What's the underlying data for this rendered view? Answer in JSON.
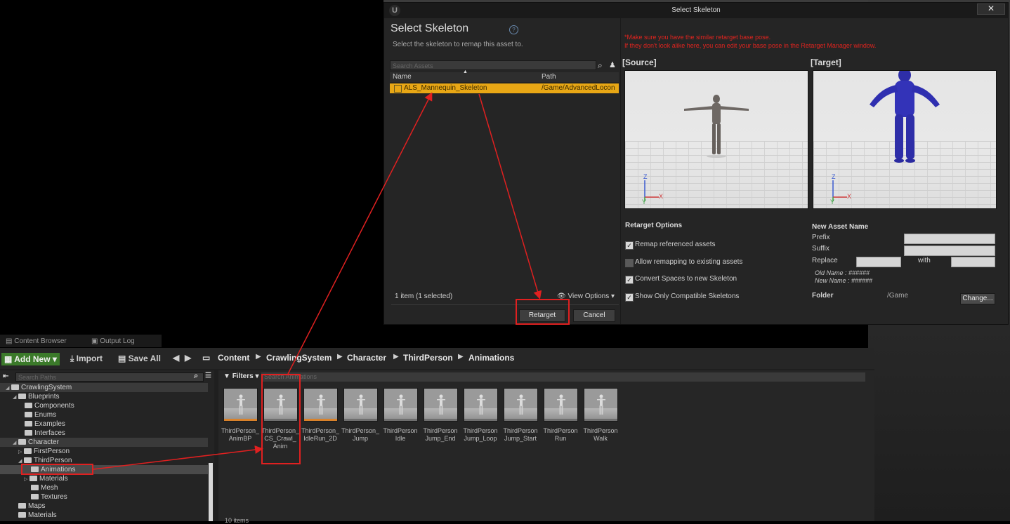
{
  "dialog": {
    "window_title": "Select Skeleton",
    "close_glyph": "✕",
    "heading": "Select Skeleton",
    "subtitle": "Select the skeleton to remap this asset to.",
    "search_placeholder": "Search Assets",
    "columns": {
      "name": "Name",
      "path": "Path"
    },
    "selected_row": {
      "name": "ALS_Mannequin_Skeleton",
      "path": "/Game/AdvancedLocon"
    },
    "count_text": "1 item (1 selected)",
    "view_options": "View Options",
    "retarget_button": "Retarget",
    "cancel_button": "Cancel",
    "warning_line1": "*Make sure you have the similar retarget base pose.",
    "warning_line2": "If they don't look alike here, you can edit your base pose in the Retarget Manager window.",
    "source_label": "[Source]",
    "target_label": "[Target]",
    "axis_z": "Z",
    "axis_x": "X",
    "axis_y": "Y",
    "retarget_options_title": "Retarget Options",
    "options": [
      {
        "label": "Remap referenced assets",
        "checked": true
      },
      {
        "label": "Allow remapping to existing assets",
        "checked": false
      },
      {
        "label": "Convert Spaces to new Skeleton",
        "checked": true
      },
      {
        "label": "Show Only Compatible Skeletons",
        "checked": true
      }
    ],
    "check_glyph": "✓",
    "new_asset_title": "New Asset Name",
    "prefix_label": "Prefix",
    "suffix_label": "Suffix",
    "replace_label": "Replace",
    "with_label": "with",
    "old_name": "Old Name : ######",
    "new_name": "New Name : ######",
    "folder_label": "Folder",
    "folder_value": "/Game",
    "change_button": "Change..."
  },
  "content_browser": {
    "tabs": [
      "Content Browser",
      "Output Log"
    ],
    "add_new": "Add New ▾",
    "import": "Import",
    "save_all": "Save All",
    "breadcrumb": [
      "Content",
      "CrawlingSystem",
      "Character",
      "ThirdPerson",
      "Animations"
    ],
    "search_paths_placeholder": "Search Paths",
    "filters": "Filters ▾",
    "search_animations_placeholder": "Search Animations",
    "tree": {
      "crawling": "CrawlingSystem",
      "blueprints": "Blueprints",
      "components": "Components",
      "enums": "Enums",
      "examples": "Examples",
      "interfaces": "Interfaces",
      "character": "Character",
      "first_person": "FirstPerson",
      "third_person": "ThirdPerson",
      "animations": "Animations",
      "materials": "Materials",
      "mesh": "Mesh",
      "textures": "Textures",
      "maps": "Maps",
      "materials_root": "Materials"
    },
    "assets": [
      {
        "line1": "ThirdPerson_",
        "line2": "AnimBP",
        "line3": ""
      },
      {
        "line1": "ThirdPerson_",
        "line2": "CS_Crawl_",
        "line3": "Anim"
      },
      {
        "line1": "ThirdPerson_",
        "line2": "IdleRun_2D",
        "line3": ""
      },
      {
        "line1": "ThirdPerson_",
        "line2": "Jump",
        "line3": ""
      },
      {
        "line1": "ThirdPerson",
        "line2": "Idle",
        "line3": ""
      },
      {
        "line1": "ThirdPerson",
        "line2": "Jump_End",
        "line3": ""
      },
      {
        "line1": "ThirdPerson",
        "line2": "Jump_Loop",
        "line3": ""
      },
      {
        "line1": "ThirdPerson",
        "line2": "Jump_Start",
        "line3": ""
      },
      {
        "line1": "ThirdPerson",
        "line2": "Run",
        "line3": ""
      },
      {
        "line1": "ThirdPerson",
        "line2": "Walk",
        "line3": ""
      }
    ],
    "items_count": "10 items"
  },
  "colors": {
    "selection": "#e8a715",
    "annotation": "#e02020",
    "warning": "#e0241f",
    "add_new": "#3b7a2a"
  }
}
